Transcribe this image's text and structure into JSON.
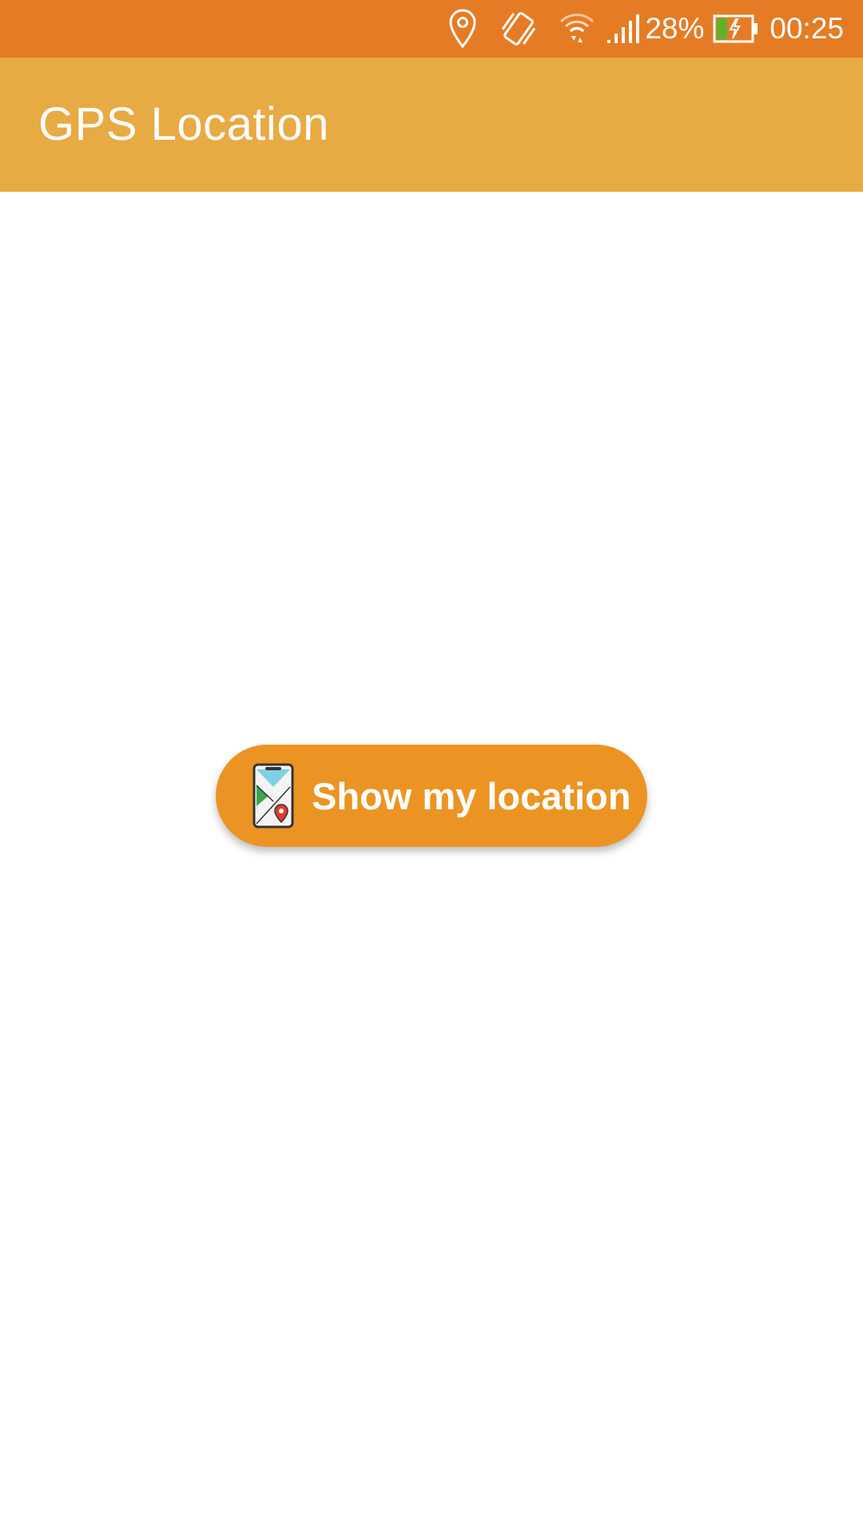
{
  "status_bar": {
    "icons": [
      "location-icon",
      "vibrate-icon",
      "wifi-icon",
      "signal-icon",
      "battery-charging-icon"
    ],
    "battery_percent": "28%",
    "time": "00:25",
    "background_color": "#e57c25"
  },
  "app_bar": {
    "title": "GPS Location",
    "background_color": "#e8aa43"
  },
  "main": {
    "show_location_button": {
      "label": "Show my location",
      "icon": "phone-map-pin-icon",
      "background_color": "#ec9423"
    }
  }
}
